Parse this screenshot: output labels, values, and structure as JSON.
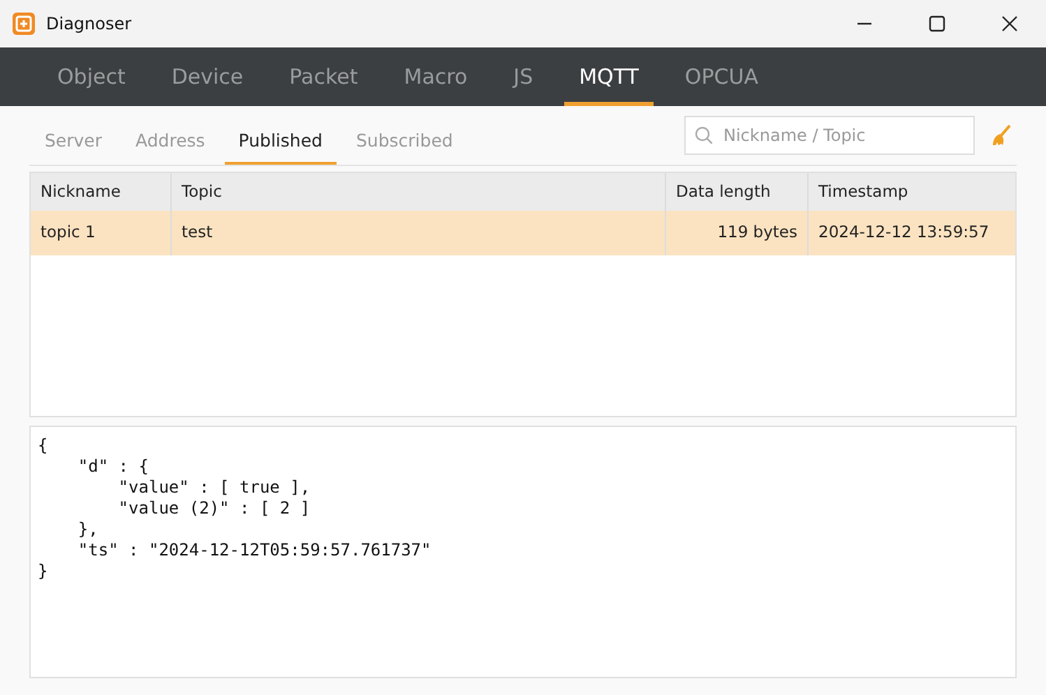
{
  "window": {
    "title": "Diagnoser"
  },
  "tabs": [
    {
      "label": "Object",
      "selected": false
    },
    {
      "label": "Device",
      "selected": false
    },
    {
      "label": "Packet",
      "selected": false
    },
    {
      "label": "Macro",
      "selected": false
    },
    {
      "label": "JS",
      "selected": false
    },
    {
      "label": "MQTT",
      "selected": true
    },
    {
      "label": "OPCUA",
      "selected": false
    }
  ],
  "subtabs": [
    {
      "label": "Server",
      "selected": false
    },
    {
      "label": "Address",
      "selected": false
    },
    {
      "label": "Published",
      "selected": true
    },
    {
      "label": "Subscribed",
      "selected": false
    }
  ],
  "search": {
    "placeholder": "Nickname / Topic"
  },
  "table": {
    "columns": [
      "Nickname",
      "Topic",
      "Data length",
      "Timestamp"
    ],
    "rows": [
      {
        "cells": [
          "topic 1",
          "test",
          "119 bytes",
          "2024-12-12 13:59:57"
        ],
        "selected": true
      }
    ]
  },
  "payload": [
    "{",
    "    \"d\" : {",
    "        \"value\" : [ true ],",
    "        \"value (2)\" : [ 2 ]",
    "    },",
    "    \"ts\" : \"2024-12-12T05:59:57.761737\"",
    "}"
  ]
}
